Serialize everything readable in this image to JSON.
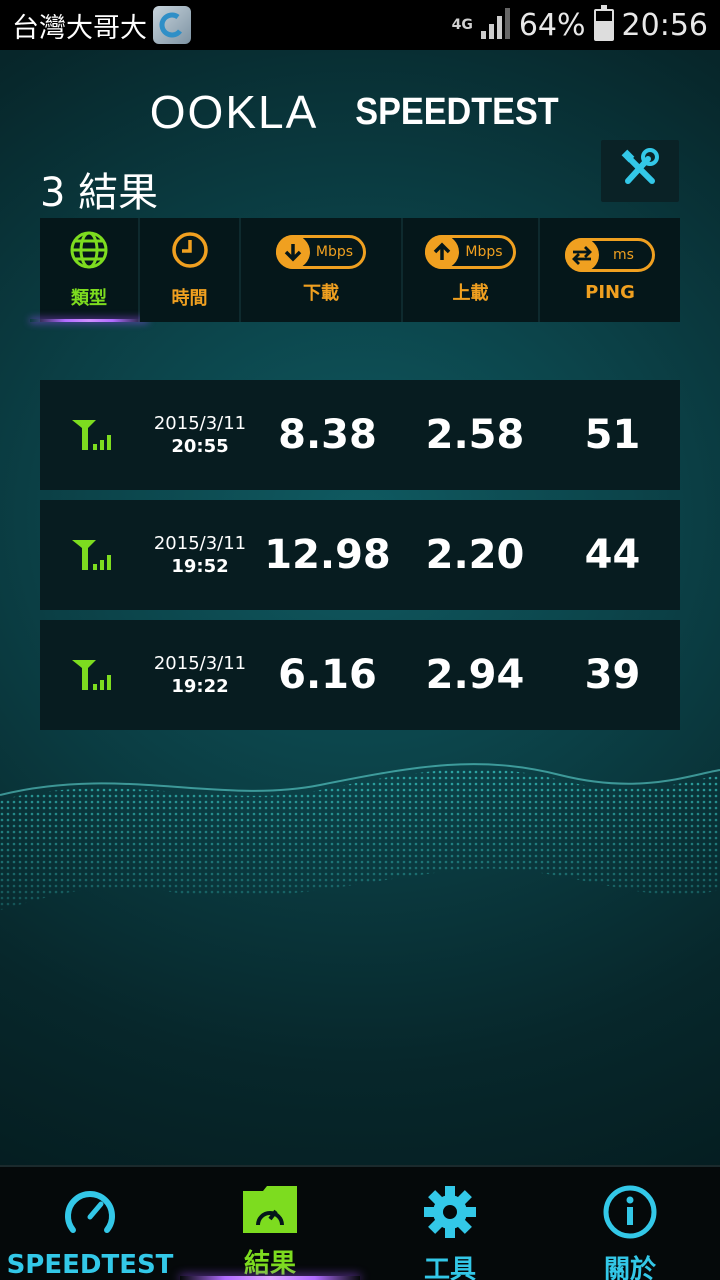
{
  "status_bar": {
    "carrier": "台灣大哥大",
    "network_type": "4G",
    "battery": "64%",
    "battery_level": 0.64,
    "time": "20:56"
  },
  "header": {
    "logo_ookla": "OOKLA",
    "logo_speedtest": "SPEEDTEST",
    "results_count": "3 結果",
    "tools_icon": "wrench-screwdriver-icon"
  },
  "sort_columns": [
    {
      "label": "類型",
      "icon": "globe-icon",
      "color": "#7ddc1f",
      "active": true
    },
    {
      "label": "時間",
      "icon": "clock-icon",
      "color": "#f0a020"
    },
    {
      "label": "下載",
      "icon": "arrow-down-icon",
      "unit": "Mbps",
      "color": "#f0a020"
    },
    {
      "label": "上載",
      "icon": "arrow-up-icon",
      "unit": "Mbps",
      "color": "#f0a020"
    },
    {
      "label": "PING",
      "icon": "swap-arrows-icon",
      "unit": "ms",
      "color": "#f0a020"
    }
  ],
  "results": [
    {
      "type_icon": "cellular-signal-icon",
      "date": "2015/3/11",
      "time": "20:55",
      "download": "8.38",
      "upload": "2.58",
      "ping": "51"
    },
    {
      "type_icon": "cellular-signal-icon",
      "date": "2015/3/11",
      "time": "19:52",
      "download": "12.98",
      "upload": "2.20",
      "ping": "44"
    },
    {
      "type_icon": "cellular-signal-icon",
      "date": "2015/3/11",
      "time": "19:22",
      "download": "6.16",
      "upload": "2.94",
      "ping": "39"
    }
  ],
  "bottom_nav": [
    {
      "label": "SPEEDTEST",
      "icon": "speedometer-icon",
      "color": "#33c8e8"
    },
    {
      "label": "結果",
      "icon": "results-folder-icon",
      "color": "#7ddc1f",
      "active": true
    },
    {
      "label": "工具",
      "icon": "gear-icon",
      "color": "#33c8e8"
    },
    {
      "label": "關於",
      "icon": "info-icon",
      "color": "#33c8e8"
    }
  ],
  "colors": {
    "accent_green": "#7ddc1f",
    "accent_orange": "#f0a020",
    "accent_cyan": "#33c8e8",
    "active_purple": "#b16cff"
  }
}
